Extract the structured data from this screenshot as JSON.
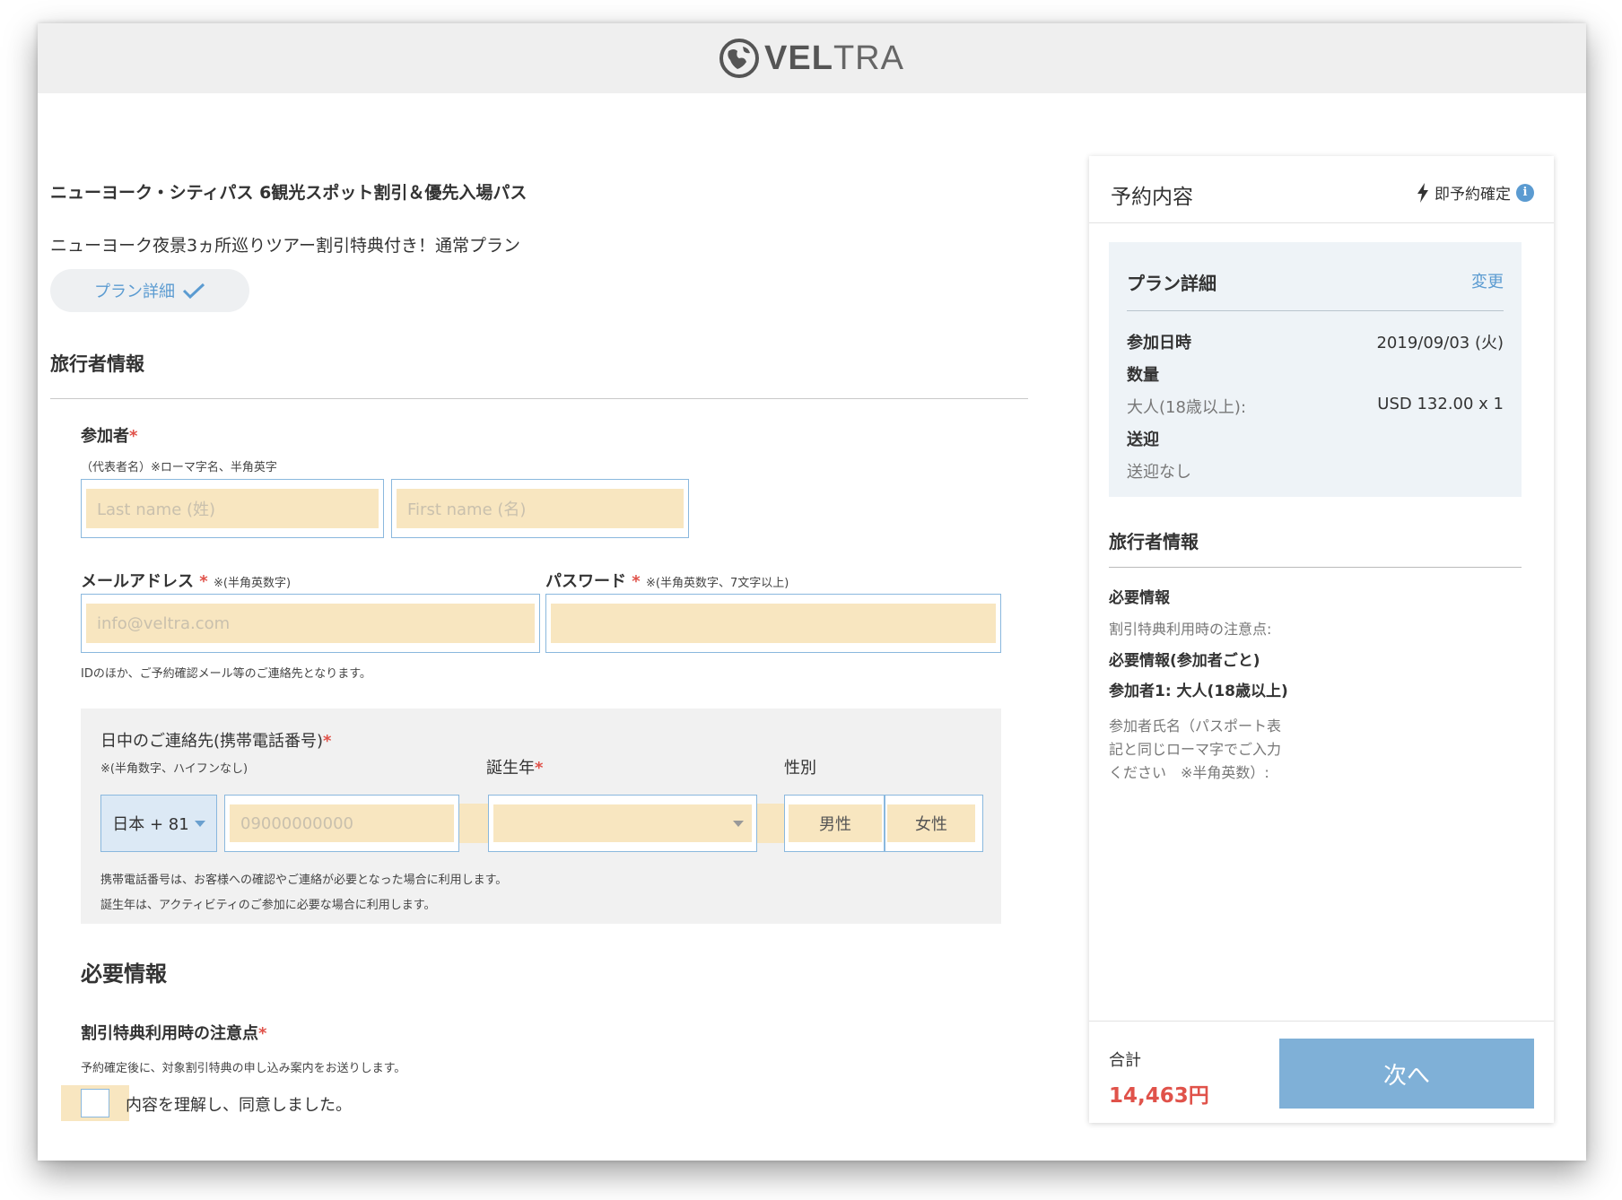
{
  "header": {
    "logo_bold": "VEL",
    "logo_light": "TRA"
  },
  "product": {
    "title": "ニューヨーク・シティパス 6観光スポット割引＆優先入場パス",
    "plan": "ニューヨーク夜景3ヵ所巡りツアー割引特典付き！通常プラン",
    "plan_detail_button": "プラン詳細"
  },
  "traveler_section": {
    "heading": "旅行者情報",
    "participant_label": "参加者",
    "participant_note": "（代表者名）※ローマ字名、半角英字",
    "last_name_placeholder": "Last name (姓)",
    "first_name_placeholder": "First name (名)",
    "email_label": "メールアドレス",
    "email_note": "※(半角英数字)",
    "email_placeholder": "info@veltra.com",
    "password_label": "パスワード",
    "password_note": "※(半角英数字、7文字以上)",
    "email_help": "IDのほか、ご予約確認メール等のご連絡先となります。",
    "required_mark": "*"
  },
  "contact_box": {
    "phone_label": "日中のご連絡先(携帯電話番号)",
    "phone_note": "※(半角数字、ハイフンなし)",
    "country_code": "日本 + 81",
    "phone_placeholder": "09000000000",
    "birth_year_label": "誕生年",
    "gender_label": "性別",
    "gender_male": "男性",
    "gender_female": "女性",
    "help_phone": "携帯電話番号は、お客様への確認やご連絡が必要となった場合に利用します。",
    "help_birth": "誕生年は、アクティビティのご参加に必要な場合に利用します。"
  },
  "required_info": {
    "heading": "必要情報",
    "discount_label": "割引特典利用時の注意点",
    "discount_note": "予約確定後に、対象割引特典の申し込み案内をお送りします。",
    "agree_label": "内容を理解し、同意しました。"
  },
  "sidebar": {
    "title": "予約内容",
    "instant_confirm": "即予約確定",
    "plan_card": {
      "title": "プラン詳細",
      "change_link": "変更",
      "date_label": "参加日時",
      "date_value": "2019/09/03 (火)",
      "qty_label": "数量",
      "adult_label": "大人(18歳以上):",
      "adult_value": "USD 132.00 x 1",
      "pickup_label": "送迎",
      "pickup_value": "送迎なし"
    },
    "traveler_heading": "旅行者情報",
    "required_info": "必要情報",
    "discount_note": "割引特典利用時の注意点:",
    "per_participant": "必要情報(参加者ごと)",
    "participant1": "参加者1: 大人(18歳以上)",
    "name_note_1": "参加者氏名（パスポート表",
    "name_note_2": "記と同じローマ字でご入力",
    "name_note_3": "ください　※半角英数）:",
    "total_label": "合計",
    "total_value": "14,463円",
    "next_button": "次へ"
  },
  "colors": {
    "accent": "#5b9bd1",
    "required": "#e0524a",
    "highlight": "#f8e6c0",
    "button": "#7fb0d7"
  }
}
